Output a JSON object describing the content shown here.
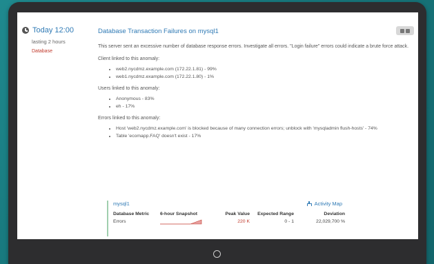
{
  "sidebar": {
    "time": "Today 12:00",
    "duration": "lasting 2 hours",
    "category": "Database"
  },
  "anomaly": {
    "title": "Database Transaction Failures on mysql1",
    "description": "This server sent an excessive number of database response errors. Investigate all errors. \"Login failure\" errors could indicate a brute force attack.",
    "sections": [
      {
        "label": "Client linked to this anomaly:",
        "items": [
          "web2.nycdmz.example.com (172.22.1.81) - 99%",
          "web1.nycdmz.example.com (172.22.1.80) - 1%"
        ]
      },
      {
        "label": "Users linked to this anomaly:",
        "items": [
          "Anonymous - 83%",
          "eh - 17%"
        ]
      },
      {
        "label": "Errors linked to this anomaly:",
        "items": [
          "Host 'web2.nycdmz.example.com' is blocked because of many connection errors; unblock with 'mysqladmin flush-hosts' - 74%",
          "Table 'ecomapp.FAQ' doesn't exist - 17%"
        ]
      }
    ]
  },
  "metrics": {
    "server": "mysql1",
    "activity_link": "Activity Map",
    "headers": [
      "Database Metric",
      "6-hour Snapshot",
      "Peak Value",
      "Expected Range",
      "Deviation"
    ],
    "row": {
      "metric": "Errors",
      "peak": "220 K",
      "range": "0 - 1",
      "deviation": "22,029,700 %"
    }
  },
  "colors": {
    "link": "#2f7ab5",
    "alert": "#c0392b",
    "panel_border": "#9fcfae"
  }
}
